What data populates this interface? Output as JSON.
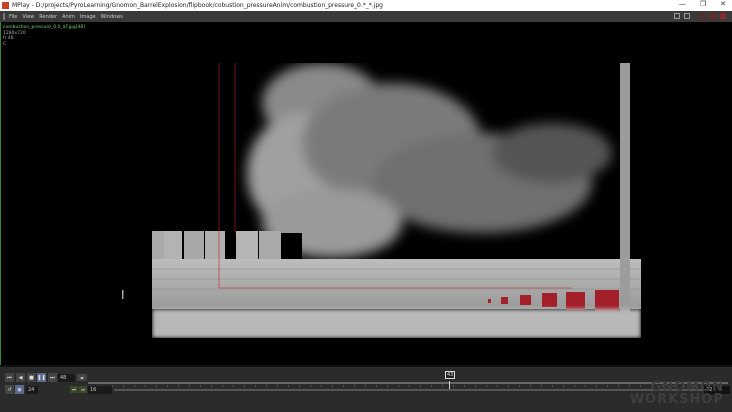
{
  "window": {
    "title": "MPlay - D:/projects/PyroLearning/Gnomon_BarrelExplosion/flipbook/cobustion_pressureAnim/combustion_pressure_0.*_*.jpg",
    "minimize": "—",
    "maximize": "❐",
    "close": "✕"
  },
  "menu": [
    "File",
    "View",
    "Render",
    "Anim",
    "Image",
    "Windows"
  ],
  "viewer": {
    "filename": "combustion_pressure_0.0_$F.jpg[48]",
    "resolution": "1280x720",
    "frame_info": "fr 48",
    "channel": "C"
  },
  "playbar": {
    "frame": "48",
    "current_frame_marker": "43",
    "fps": "24",
    "range_start": "16",
    "range_end": "72",
    "buttons": [
      "first",
      "step-back",
      "stop",
      "pause",
      "last"
    ]
  },
  "watermark": {
    "line1": "GNOMON",
    "line2": "WORKSHOP"
  },
  "colors": {
    "accent_green": "#6fd26f",
    "barrel_red": "#a3202a"
  }
}
